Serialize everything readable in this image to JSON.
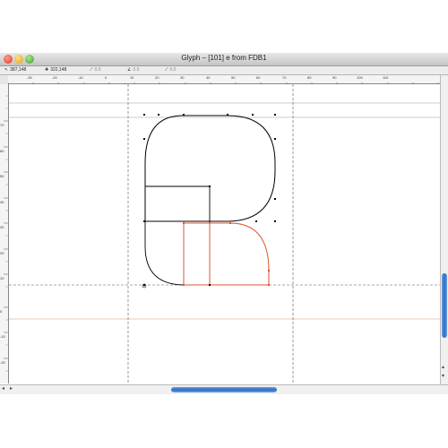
{
  "window": {
    "title": "Glyph – [101] e from FDB1"
  },
  "infobar": {
    "pointer_coords": "387,148",
    "alt_coords": "322,148",
    "distance": "0.0",
    "angle": "0.0",
    "extra": "0.0"
  },
  "ruler": {
    "h_labels": [
      "-30",
      "-20",
      "-10",
      "0",
      "10",
      "20",
      "30",
      "40",
      "50",
      "60",
      "70",
      "80",
      "90",
      "100",
      "110"
    ],
    "v_labels": [
      "70",
      "60",
      "50",
      "40",
      "30",
      "20",
      "10",
      "0",
      "-10",
      "-20"
    ],
    "metric_marks": [
      "D",
      "D"
    ]
  },
  "colors": {
    "glyph_outline": "#000000",
    "component_outline": "#e0542f",
    "guide_line": "#e7b7a6",
    "metric_line": "#9a9a9a",
    "scroll_thumb": "#2d6cc8"
  },
  "icons": {
    "close": "red-circle",
    "minimize": "yellow-circle",
    "zoom": "green-circle"
  }
}
